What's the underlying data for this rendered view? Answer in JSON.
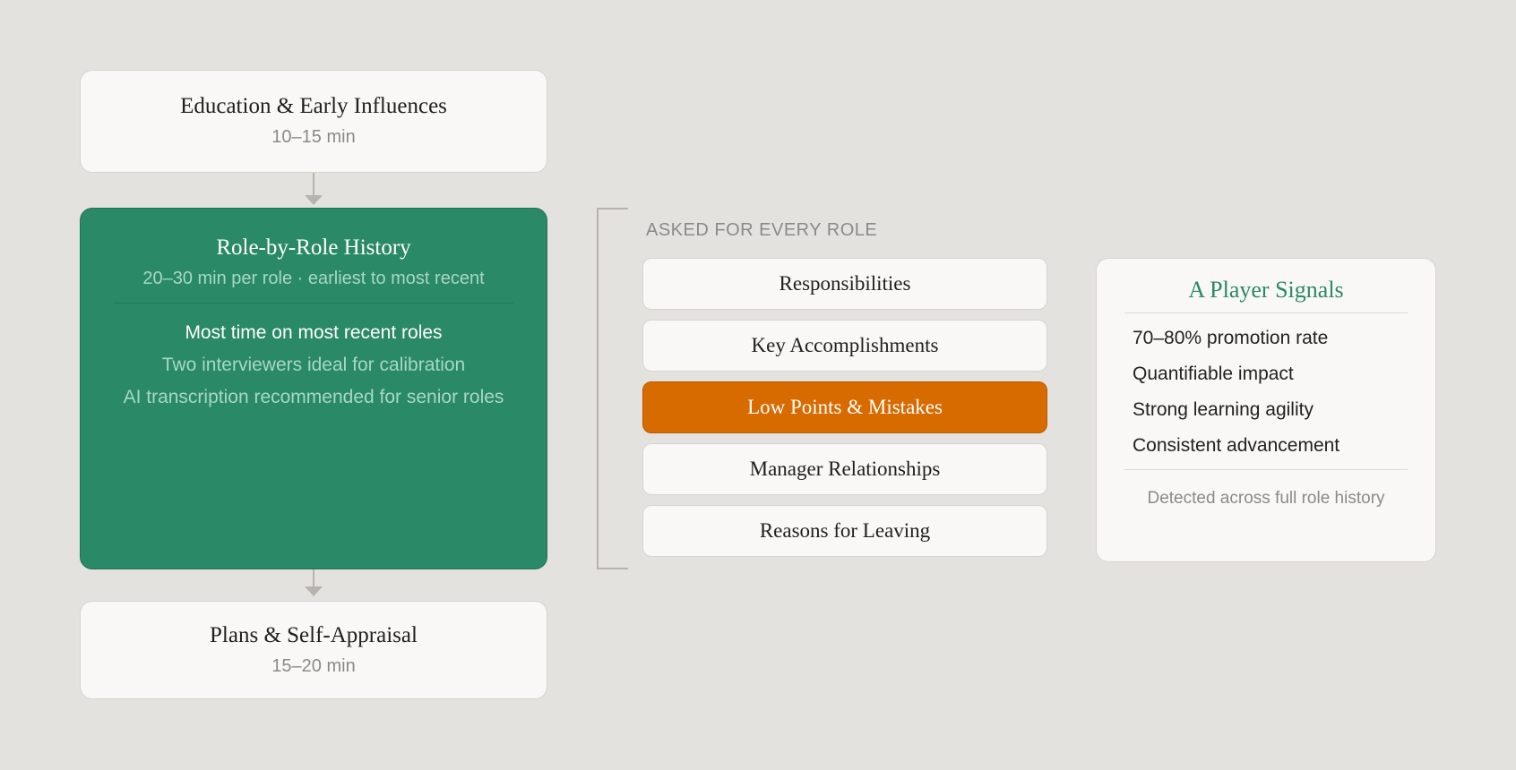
{
  "stages": {
    "education": {
      "title": "Education & Early Influences",
      "duration": "10–15 min"
    },
    "role_history": {
      "title": "Role-by-Role History",
      "subtitle": "20–30 min per role · earliest to most recent",
      "notes": [
        "Most time on most recent roles",
        "Two interviewers ideal for calibration",
        "AI transcription recommended for senior roles"
      ]
    },
    "plans": {
      "title": "Plans & Self-Appraisal",
      "duration": "15–20 min"
    }
  },
  "questions": {
    "label": "ASKED FOR EVERY ROLE",
    "items": [
      {
        "label": "Responsibilities",
        "highlighted": false
      },
      {
        "label": "Key Accomplishments",
        "highlighted": false
      },
      {
        "label": "Low Points & Mistakes",
        "highlighted": true
      },
      {
        "label": "Manager Relationships",
        "highlighted": false
      },
      {
        "label": "Reasons for Leaving",
        "highlighted": false
      }
    ],
    "highlight_color": "#d76b00"
  },
  "signals": {
    "title": "A Player Signals",
    "items": [
      "70–80% promotion rate",
      "Quantifiable impact",
      "Strong learning agility",
      "Consistent advancement"
    ],
    "footer": "Detected across full role history"
  },
  "colors": {
    "background": "#e4e2de",
    "card": "#f9f8f6",
    "role_card": "#2a8966",
    "accent_orange": "#d76b00",
    "connector": "#b7b4af"
  }
}
